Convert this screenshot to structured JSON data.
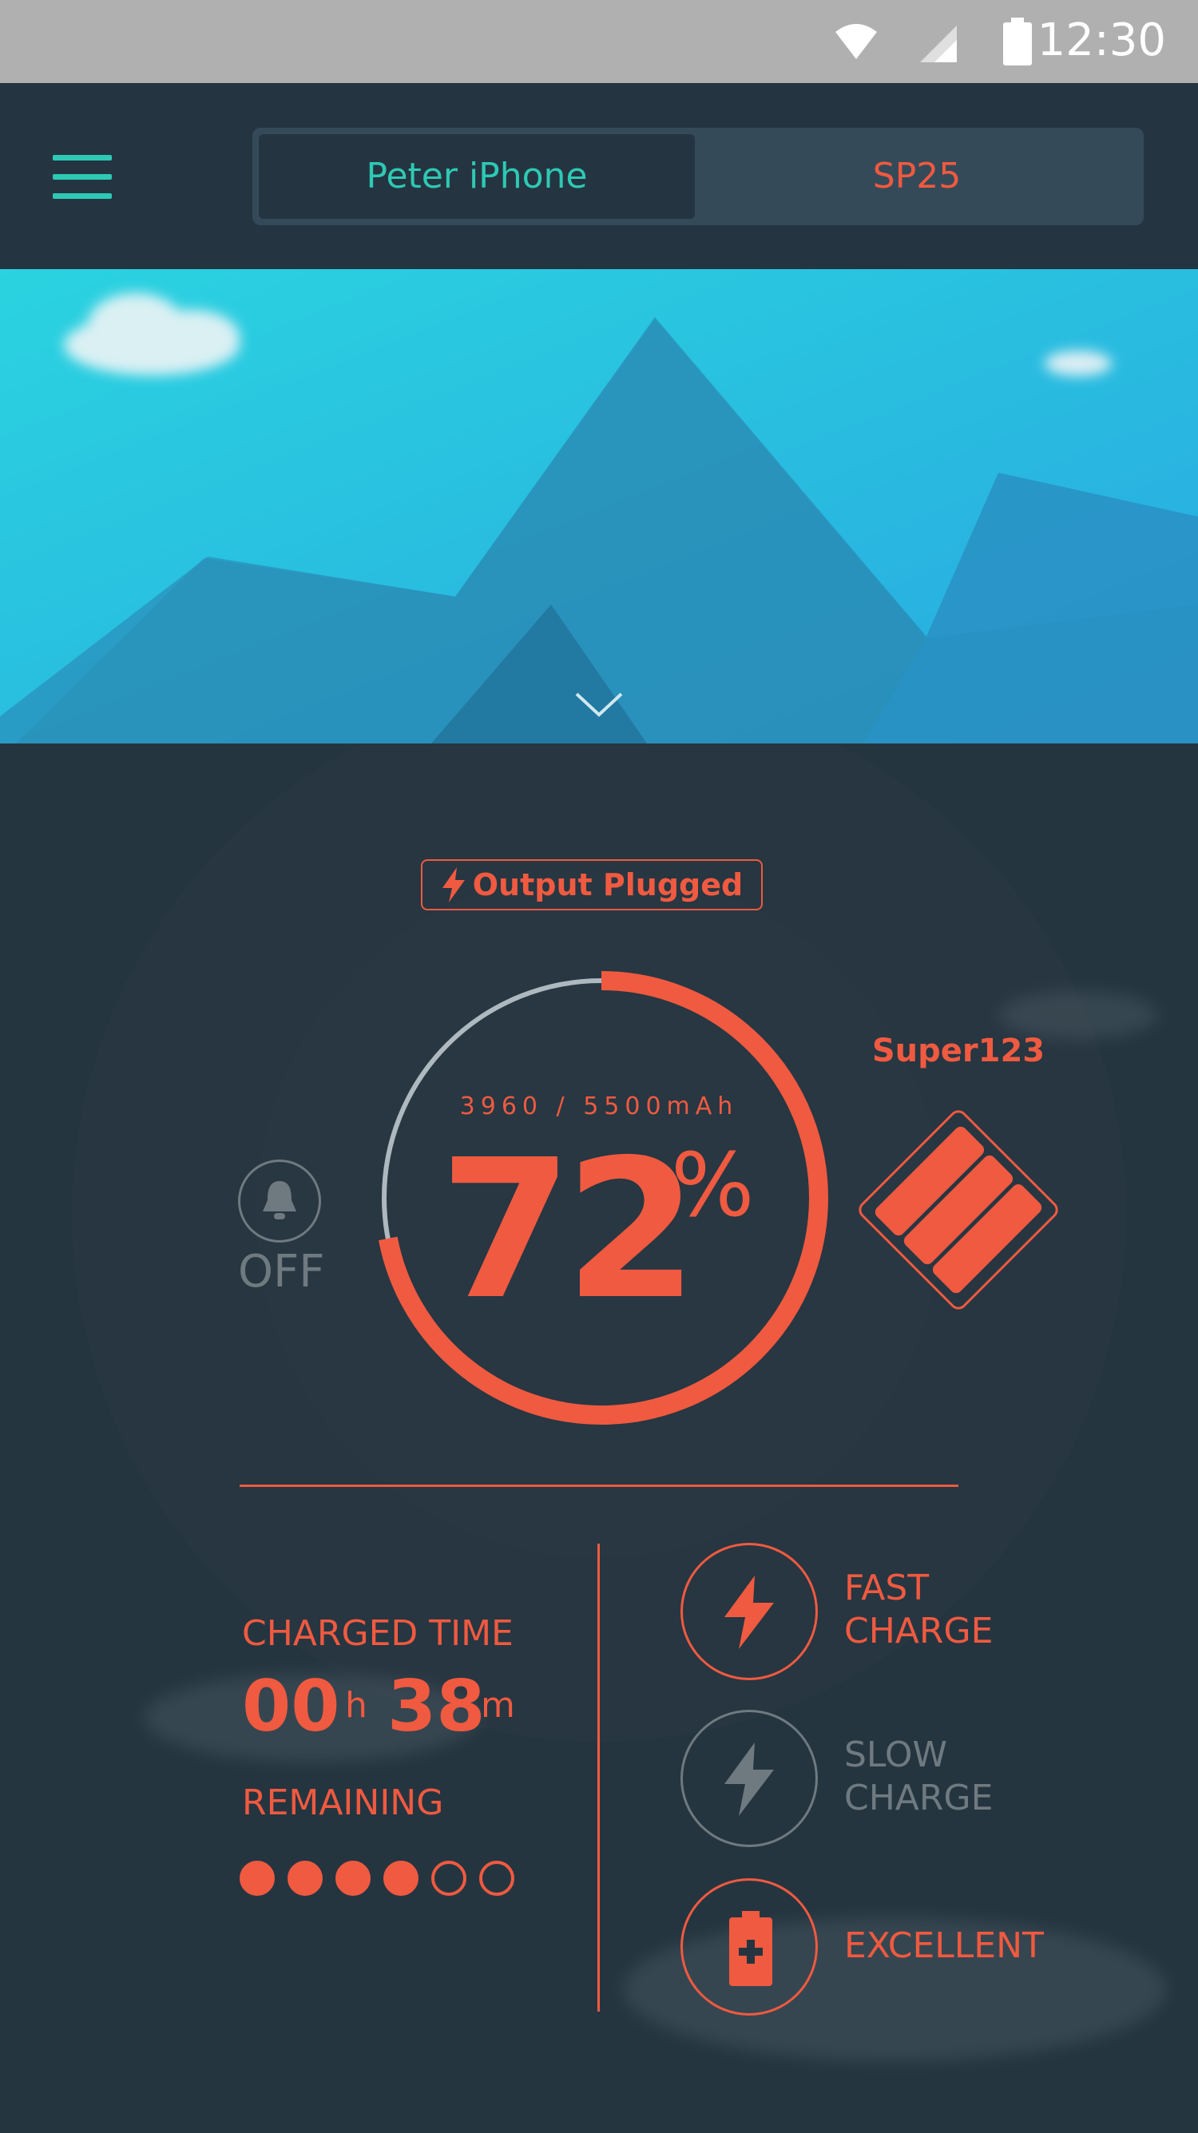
{
  "status_bar": {
    "time": "12:30",
    "icons": [
      "wifi-icon",
      "cell-signal-icon",
      "battery-icon"
    ]
  },
  "app_bar": {
    "menu_icon": "hamburger-menu-icon",
    "tabs": [
      {
        "label": "Peter iPhone",
        "active": true
      },
      {
        "label": "SP25",
        "active": false
      }
    ]
  },
  "hero": {
    "icon": "chevron-down-icon"
  },
  "status_badge": {
    "icon": "lightning-icon",
    "label": "Output Plugged"
  },
  "gauge": {
    "capacity_text": "3960 / 5500mAh",
    "percent_value": "72",
    "percent_unit": "%",
    "fill_fraction": 0.72
  },
  "alarm": {
    "icon": "bell-icon",
    "state": "OFF"
  },
  "device": {
    "name": "Super123",
    "icon": "power-bank-icon"
  },
  "charged_time": {
    "label": "CHARGED TIME",
    "hours": "00",
    "hours_unit": "h",
    "minutes": "38",
    "minutes_unit": "m"
  },
  "remaining": {
    "label": "REMAINING",
    "filled_dots": 4,
    "total_dots": 6
  },
  "modes": [
    {
      "label_line1": "FAST",
      "label_line2": "CHARGE",
      "icon": "lightning-icon",
      "active": true
    },
    {
      "label_line1": "SLOW",
      "label_line2": "CHARGE",
      "icon": "lightning-icon",
      "active": false
    },
    {
      "label_line1": "EXCELLENT",
      "label_line2": "",
      "icon": "battery-plus-icon",
      "active": true
    }
  ],
  "colors": {
    "accent": "#f05a40",
    "teal": "#2ec9b4",
    "background": "#253540",
    "inactive": "#6f7a80"
  }
}
